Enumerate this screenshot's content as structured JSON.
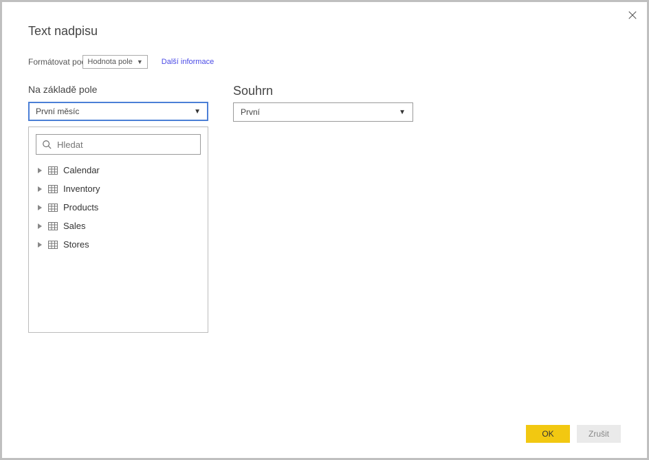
{
  "title": "Text nadpisu",
  "format_label": "Formátovat podle",
  "format_select_value": "Hodnota pole",
  "more_info": "Další informace",
  "field_basis_label": "Na základě pole",
  "field_basis_value": "První měsíc",
  "summary_label": "Souhrn",
  "summary_value": "První",
  "search_placeholder": "Hledat",
  "tables": [
    {
      "name": "Calendar"
    },
    {
      "name": "Inventory"
    },
    {
      "name": "Products"
    },
    {
      "name": "Sales"
    },
    {
      "name": "Stores"
    }
  ],
  "buttons": {
    "ok": "OK",
    "cancel": "Zrušit"
  }
}
